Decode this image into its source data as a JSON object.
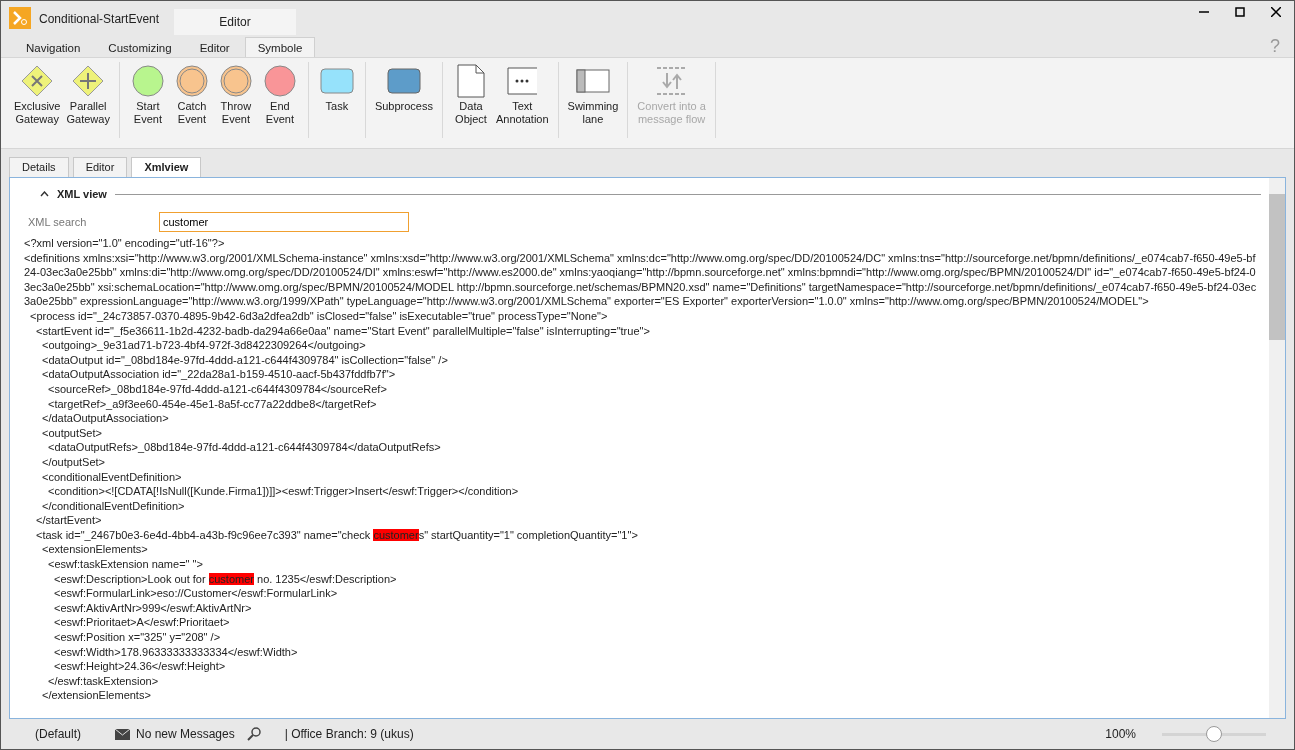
{
  "window": {
    "title": "Conditional-StartEvent",
    "context_tab": "Editor"
  },
  "ribbon_tabs": [
    {
      "label": "Navigation",
      "selected": false
    },
    {
      "label": "Customizing",
      "selected": false
    },
    {
      "label": "Editor",
      "selected": false
    },
    {
      "label": "Symbole",
      "selected": true
    }
  ],
  "help": "?",
  "ribbon_groups": [
    {
      "items": [
        {
          "kind": "gateway-x",
          "label": "Exclusive\nGateway",
          "disabled": false
        },
        {
          "kind": "gateway-plus",
          "label": "Parallel\nGateway",
          "disabled": false
        }
      ]
    },
    {
      "items": [
        {
          "kind": "start",
          "label": "Start\nEvent",
          "disabled": false
        },
        {
          "kind": "catch",
          "label": "Catch\nEvent",
          "disabled": false
        },
        {
          "kind": "throw",
          "label": "Throw\nEvent",
          "disabled": false
        },
        {
          "kind": "end",
          "label": "End\nEvent",
          "disabled": false
        }
      ]
    },
    {
      "items": [
        {
          "kind": "task",
          "label": "Task",
          "disabled": false
        }
      ]
    },
    {
      "items": [
        {
          "kind": "subprocess",
          "label": "Subprocess",
          "disabled": false
        }
      ]
    },
    {
      "items": [
        {
          "kind": "data",
          "label": "Data\nObject",
          "disabled": false
        },
        {
          "kind": "annotation",
          "label": "Text\nAnnotation",
          "disabled": false
        }
      ]
    },
    {
      "items": [
        {
          "kind": "lane",
          "label": "Swimming\nlane",
          "disabled": false
        }
      ]
    },
    {
      "items": [
        {
          "kind": "convert",
          "label": "Convert into a\nmessage flow",
          "disabled": true
        }
      ]
    }
  ],
  "view_tabs": [
    {
      "label": "Details",
      "selected": false
    },
    {
      "label": "Editor",
      "selected": false
    },
    {
      "label": "Xmlview",
      "selected": true
    }
  ],
  "section": {
    "title": "XML view",
    "expanded": true
  },
  "search": {
    "label": "XML search",
    "value": "customer"
  },
  "xml_lines": [
    {
      "parts": [
        {
          "text": "<?xml version=\"1.0\" encoding=\"utf-16\"?>",
          "match": false
        }
      ]
    },
    {
      "parts": [
        {
          "text": "<definitions xmlns:xsi=\"http://www.w3.org/2001/XMLSchema-instance\" xmlns:xsd=\"http://www.w3.org/2001/XMLSchema\" xmlns:dc=\"http://www.omg.org/spec/DD/20100524/DC\" xmlns:tns=\"http://sourceforge.net/bpmn/definitions/_e074cab7-f650-49e5-bf24-03ec3a0e25bb\" xmlns:di=\"http://www.omg.org/spec/DD/20100524/DI\" xmlns:eswf=\"http://www.es2000.de\" xmlns:yaoqiang=\"http://bpmn.sourceforge.net\" xmlns:bpmndi=\"http://www.omg.org/spec/BPMN/20100524/DI\" id=\"_e074cab7-f650-49e5-bf24-03ec3a0e25bb\" xsi:schemaLocation=\"http://www.omg.org/spec/BPMN/20100524/MODEL http://bpmn.sourceforge.net/schemas/BPMN20.xsd\" name=\"Definitions\" targetNamespace=\"http://sourceforge.net/bpmn/definitions/_e074cab7-f650-49e5-bf24-03ec3a0e25bb\" expressionLanguage=\"http://www.w3.org/1999/XPath\" typeLanguage=\"http://www.w3.org/2001/XMLSchema\" exporter=\"ES Exporter\" exporterVersion=\"1.0.0\" xmlns=\"http://www.omg.org/spec/BPMN/20100524/MODEL\">",
          "match": false
        }
      ],
      "children": [
        {
          "parts": [
            {
              "text": "<process id=\"_24c73857-0370-4895-9b42-6d3a2dfea2db\" isClosed=\"false\" isExecutable=\"true\" processType=\"None\">",
              "match": false
            }
          ],
          "children": [
            {
              "parts": [
                {
                  "text": "<startEvent id=\"_f5e36611-1b2d-4232-badb-da294a66e0aa\" name=\"Start Event\" parallelMultiple=\"false\" isInterrupting=\"true\">",
                  "match": false
                }
              ],
              "children": [
                {
                  "parts": [
                    {
                      "text": "<outgoing>_9e31ad71-b723-4bf4-972f-3d8422309264</outgoing>",
                      "match": false
                    }
                  ]
                },
                {
                  "parts": [
                    {
                      "text": "<dataOutput id=\"_08bd184e-97fd-4ddd-a121-c644f4309784\" isCollection=\"false\" />",
                      "match": false
                    }
                  ]
                },
                {
                  "parts": [
                    {
                      "text": "<dataOutputAssociation id=\"_22da28a1-b159-4510-aacf-5b437fddfb7f\">",
                      "match": false
                    }
                  ],
                  "children": [
                    {
                      "parts": [
                        {
                          "text": "<sourceRef>_08bd184e-97fd-4ddd-a121-c644f4309784</sourceRef>",
                          "match": false
                        }
                      ]
                    },
                    {
                      "parts": [
                        {
                          "text": "<targetRef>_a9f3ee60-454e-45e1-8a5f-cc77a22ddbe8</targetRef>",
                          "match": false
                        }
                      ]
                    }
                  ]
                },
                {
                  "parts": [
                    {
                      "text": "</dataOutputAssociation>",
                      "match": false
                    }
                  ]
                },
                {
                  "parts": [
                    {
                      "text": "<outputSet>",
                      "match": false
                    }
                  ],
                  "children": [
                    {
                      "parts": [
                        {
                          "text": "<dataOutputRefs>_08bd184e-97fd-4ddd-a121-c644f4309784</dataOutputRefs>",
                          "match": false
                        }
                      ]
                    }
                  ]
                },
                {
                  "parts": [
                    {
                      "text": "</outputSet>",
                      "match": false
                    }
                  ]
                },
                {
                  "parts": [
                    {
                      "text": "<conditionalEventDefinition>",
                      "match": false
                    }
                  ],
                  "children": [
                    {
                      "parts": [
                        {
                          "text": "<condition><![CDATA[!IsNull([Kunde.Firma1])]]><eswf:Trigger>Insert</eswf:Trigger></condition>",
                          "match": false
                        }
                      ]
                    }
                  ]
                },
                {
                  "parts": [
                    {
                      "text": "</conditionalEventDefinition>",
                      "match": false
                    }
                  ]
                }
              ]
            },
            {
              "parts": [
                {
                  "text": "</startEvent>",
                  "match": false
                }
              ]
            },
            {
              "parts": [
                {
                  "text": "<task id=\"_2467b0e3-6e4d-4bb4-a43b-f9c96ee7c393\" name=\"check ",
                  "match": false
                },
                {
                  "text": "customer",
                  "match": true
                },
                {
                  "text": "s\" startQuantity=\"1\" completionQuantity=\"1\">",
                  "match": false
                }
              ],
              "children": [
                {
                  "parts": [
                    {
                      "text": "<extensionElements>",
                      "match": false
                    }
                  ],
                  "children": [
                    {
                      "parts": [
                        {
                          "text": "<eswf:taskExtension name=\" \">",
                          "match": false
                        }
                      ],
                      "children": [
                        {
                          "parts": [
                            {
                              "text": "<eswf:Description>Look out for ",
                              "match": false
                            },
                            {
                              "text": "customer",
                              "match": true
                            },
                            {
                              "text": " no. 1235</eswf:Description>",
                              "match": false
                            }
                          ]
                        },
                        {
                          "parts": [
                            {
                              "text": "<eswf:FormularLink>eso://Customer</eswf:FormularLink>",
                              "match": false
                            }
                          ]
                        },
                        {
                          "parts": [
                            {
                              "text": "<eswf:AktivArtNr>999</eswf:AktivArtNr>",
                              "match": false
                            }
                          ]
                        },
                        {
                          "parts": [
                            {
                              "text": "<eswf:Prioritaet>A</eswf:Prioritaet>",
                              "match": false
                            }
                          ]
                        },
                        {
                          "parts": [
                            {
                              "text": "<eswf:Position x=\"325\" y=\"208\" />",
                              "match": false
                            }
                          ]
                        },
                        {
                          "parts": [
                            {
                              "text": "<eswf:Width>178.96333333333334</eswf:Width>",
                              "match": false
                            }
                          ]
                        },
                        {
                          "parts": [
                            {
                              "text": "<eswf:Height>24.36</eswf:Height>",
                              "match": false
                            }
                          ]
                        }
                      ]
                    },
                    {
                      "parts": [
                        {
                          "text": "</eswf:taskExtension>",
                          "match": false
                        }
                      ]
                    }
                  ]
                },
                {
                  "parts": [
                    {
                      "text": "</extensionElements>",
                      "match": false
                    }
                  ]
                }
              ]
            }
          ]
        }
      ]
    }
  ],
  "status_bar": {
    "profile": "(Default)",
    "messages": "No new Messages",
    "branch": "| Office Branch:  9 (ukus)",
    "zoom": "100%",
    "zoom_slider": {
      "level": 0.5
    }
  }
}
